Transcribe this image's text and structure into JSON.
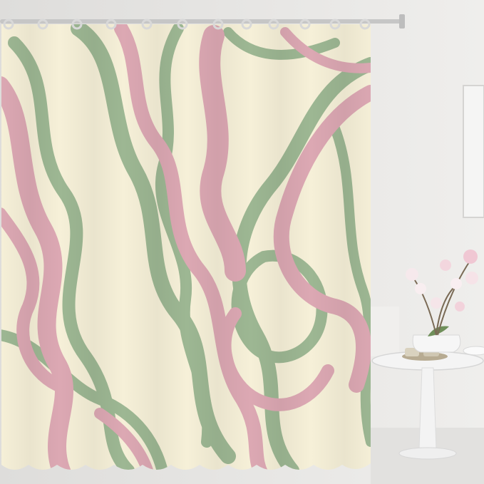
{
  "scene": {
    "subject": "swirl-pattern-shower-curtain",
    "hook_count": 11,
    "colors": {
      "wall": "#e7e6e4",
      "wall_shadow": "#d9d8d6",
      "curtain_base": "#f6f0d8",
      "swirl_pink": "#dca8b3",
      "swirl_green": "#9db793",
      "rod": "#c9c9c9",
      "hook": "#d8d8d8",
      "table": "#f2f2f2",
      "flower_pink": "#f0c7d3",
      "stem": "#7a6a55"
    },
    "icons": [
      "orchid-plant",
      "side-table",
      "shower-rod",
      "curtain-hook"
    ]
  }
}
